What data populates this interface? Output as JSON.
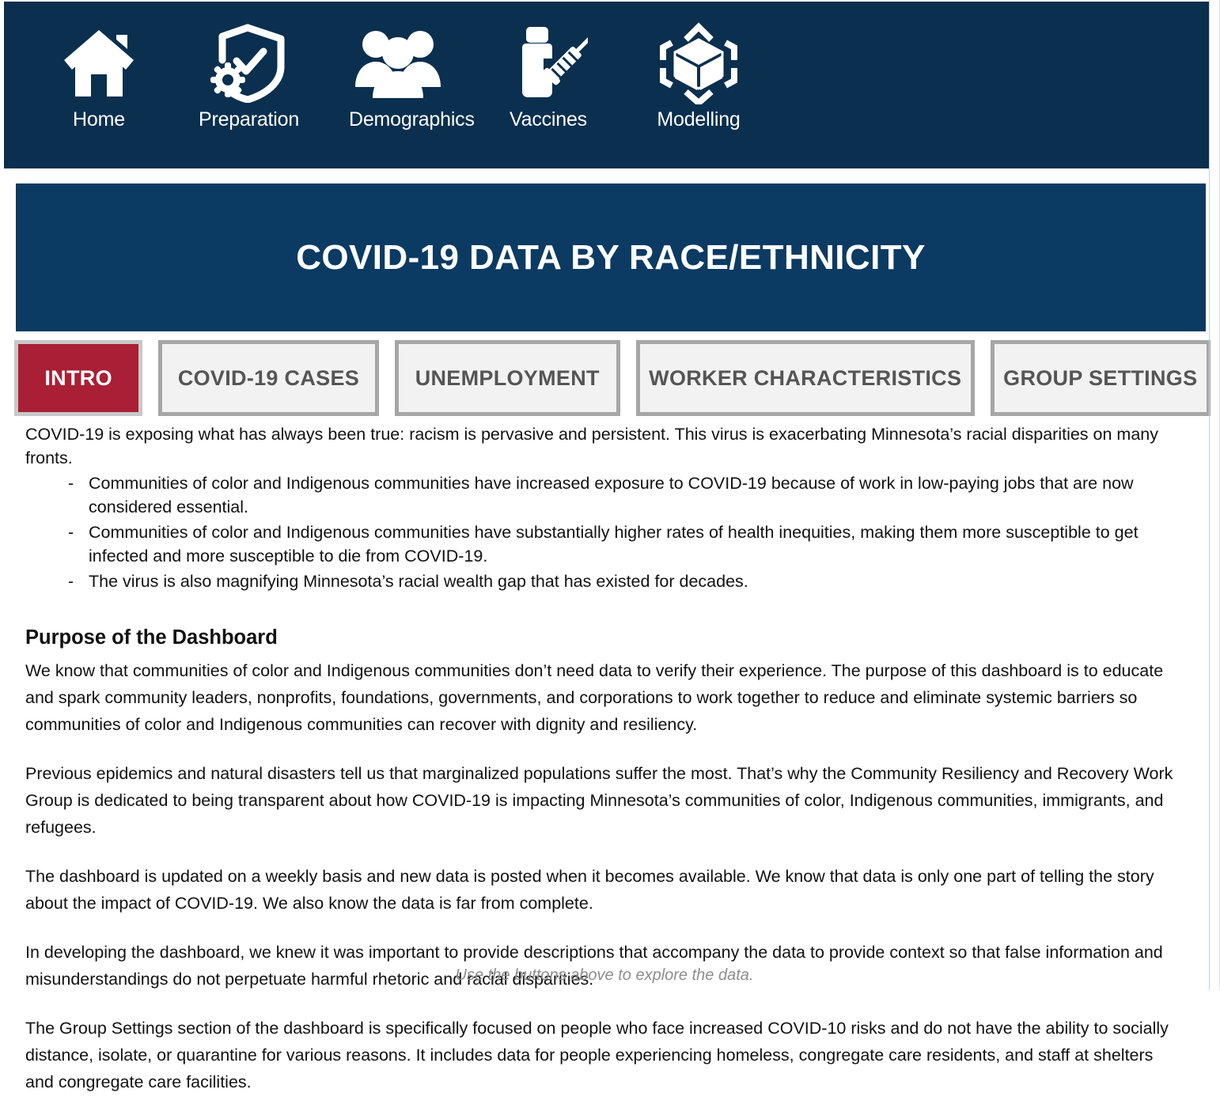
{
  "nav": {
    "items": [
      {
        "label": "Home",
        "icon": "home-icon"
      },
      {
        "label": "Preparation",
        "icon": "shield-check-virus-icon"
      },
      {
        "label": "Demographics",
        "icon": "people-group-icon"
      },
      {
        "label": "Vaccines",
        "icon": "vaccine-syringe-bottle-icon"
      },
      {
        "label": "Modelling",
        "icon": "cube-model-icon"
      }
    ]
  },
  "banner": {
    "title": "COVID-19 DATA BY RACE/ETHNICITY",
    "color": "#0B3A63"
  },
  "tabs": {
    "active_index": 0,
    "active_color": "#A91F35",
    "inactive_fill": "#F2F2F2",
    "border_color": "#A6A6A6",
    "items": [
      {
        "label": "INTRO"
      },
      {
        "label": "COVID-19 CASES"
      },
      {
        "label": "UNEMPLOYMENT"
      },
      {
        "label": "WORKER CHARACTERISTICS"
      },
      {
        "label": "GROUP SETTINGS"
      }
    ]
  },
  "intro": {
    "lead": "COVID-19 is exposing what has always been true: racism is pervasive and persistent. This virus is exacerbating Minnesota’s racial disparities on many fronts.",
    "bullet_marker": "-",
    "bullets": [
      "Communities of color and Indigenous communities have increased exposure to COVID-19 because of work in low-paying jobs that are now considered essential.",
      "Communities of color and Indigenous communities have substantially higher rates of health inequities, making them more susceptible to get infected and more susceptible to die from COVID-19.",
      "The virus is also magnifying Minnesota’s racial wealth gap that has existed for decades."
    ]
  },
  "purpose": {
    "heading": "Purpose of the Dashboard",
    "paragraphs": [
      "We know that communities of color and Indigenous communities don’t need data to verify their experience. The purpose of this dashboard is to educate and spark community leaders, nonprofits, foundations, governments, and corporations to work together to reduce and eliminate systemic barriers so communities of color and Indigenous communities can recover with dignity and resiliency.",
      "Previous epidemics and natural disasters tell us that marginalized populations suffer the most. That’s why the Community Resiliency and Recovery Work Group is dedicated to being transparent about how COVID-19 is impacting Minnesota’s communities of color, Indigenous communities, immigrants, and refugees.",
      "The dashboard is updated on a weekly basis and new data is posted when it becomes available. We know that data is only one part of telling the story about the impact of COVID-19. We also know the data is far from complete.",
      "In developing the dashboard, we knew it was important to provide descriptions that accompany the data to provide context so that false information and misunderstandings do not perpetuate harmful rhetoric and racial disparities.",
      "The Group Settings section of the dashboard is specifically focused on people who face increased COVID-10 risks and do not have the ability to socially distance, isolate, or quarantine for various reasons. It includes data for people experiencing homeless, congregate care residents, and staff at shelters and congregate care facilities."
    ]
  },
  "footer": {
    "note": "Use the buttons above to explore the data."
  }
}
